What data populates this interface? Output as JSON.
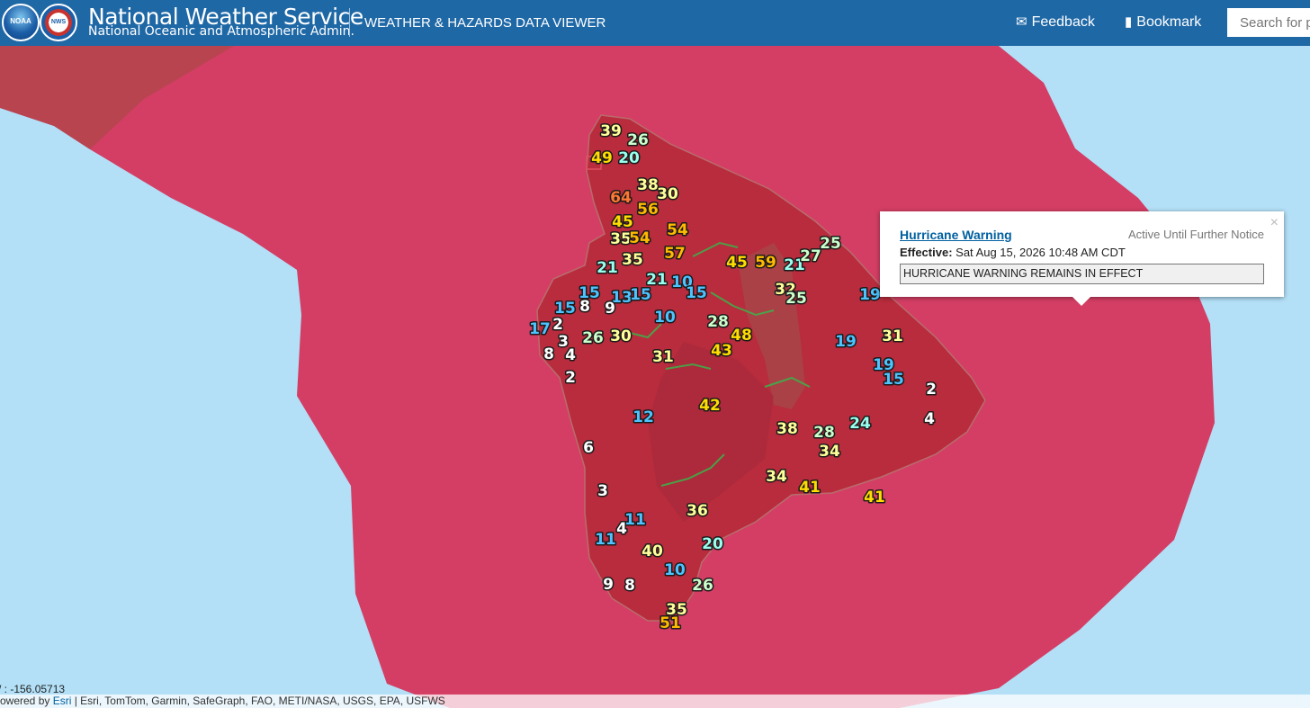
{
  "header": {
    "logo_noaa": "NOAA",
    "logo_nws": "NWS",
    "title": "National Weather Service",
    "subtitle": "National Oceanic and Atmospheric Admin.",
    "viewer_title": "WEATHER & HAZARDS DATA VIEWER",
    "feedback_label": "Feedback",
    "feedback_icon": "envelope-icon",
    "bookmark_label": "Bookmark",
    "bookmark_icon": "bookmark-icon",
    "search_placeholder": "Search for p"
  },
  "popup": {
    "title": "Hurricane Warning",
    "status": "Active Until Further Notice",
    "effective_label": "Effective:",
    "effective_value": "Sat Aug 15, 2026 10:48 AM CDT",
    "message": "HURRICANE WARNING REMAINS IN EFFECT",
    "close_glyph": "×"
  },
  "map": {
    "ocean_color": "#b3e0f7",
    "warning_color": "#d43e64",
    "island_color": "#b82c3d",
    "coords_text": "/ : -156.05713",
    "attribution_prefix": "owered by ",
    "attribution_link": "Esri",
    "attribution_rest": " | Esri, TomTom, Garmin, SafeGraph, FAO, METI/NASA, USGS, EPA, USFWS",
    "observations": [
      {
        "value": "39",
        "color": "#ffff99"
      },
      {
        "value": "26",
        "color": "#ccffcc"
      },
      {
        "value": "49",
        "color": "#ffdd00"
      },
      {
        "value": "20",
        "color": "#99ffee"
      },
      {
        "value": "38",
        "color": "#ffff99"
      },
      {
        "value": "30",
        "color": "#ffff99"
      },
      {
        "value": "64",
        "color": "#ff7733"
      },
      {
        "value": "56",
        "color": "#ffbb00"
      },
      {
        "value": "45",
        "color": "#ffdd00"
      },
      {
        "value": "54",
        "color": "#ffbb00"
      },
      {
        "value": "35",
        "color": "#ffff99"
      },
      {
        "value": "54",
        "color": "#ffbb00"
      },
      {
        "value": "35",
        "color": "#ffff99"
      },
      {
        "value": "57",
        "color": "#ffbb00"
      },
      {
        "value": "21",
        "color": "#99ffee"
      },
      {
        "value": "21",
        "color": "#99ffee"
      },
      {
        "value": "10",
        "color": "#4dc3ff"
      },
      {
        "value": "15",
        "color": "#4dc3ff"
      },
      {
        "value": "15",
        "color": "#4dc3ff"
      },
      {
        "value": "13",
        "color": "#4dc3ff"
      },
      {
        "value": "15",
        "color": "#4dc3ff"
      },
      {
        "value": "15",
        "color": "#4dc3ff"
      },
      {
        "value": "8",
        "color": "#ffffff"
      },
      {
        "value": "9",
        "color": "#ffffff"
      },
      {
        "value": "10",
        "color": "#4dc3ff"
      },
      {
        "value": "17",
        "color": "#4dc3ff"
      },
      {
        "value": "2",
        "color": "#ffffff"
      },
      {
        "value": "3",
        "color": "#ffffff"
      },
      {
        "value": "26",
        "color": "#ccffcc"
      },
      {
        "value": "30",
        "color": "#ffff99"
      },
      {
        "value": "8",
        "color": "#ffffff"
      },
      {
        "value": "4",
        "color": "#ffffff"
      },
      {
        "value": "2",
        "color": "#ffffff"
      },
      {
        "value": "31",
        "color": "#ffff99"
      },
      {
        "value": "28",
        "color": "#ccffcc"
      },
      {
        "value": "48",
        "color": "#ffdd00"
      },
      {
        "value": "43",
        "color": "#ffdd00"
      },
      {
        "value": "45",
        "color": "#ffdd00"
      },
      {
        "value": "59",
        "color": "#ffbb00"
      },
      {
        "value": "21",
        "color": "#99ffee"
      },
      {
        "value": "27",
        "color": "#ccffcc"
      },
      {
        "value": "25",
        "color": "#ccffcc"
      },
      {
        "value": "32",
        "color": "#ffff99"
      },
      {
        "value": "25",
        "color": "#ccffcc"
      },
      {
        "value": "19",
        "color": "#4dc3ff"
      },
      {
        "value": "19",
        "color": "#4dc3ff"
      },
      {
        "value": "31",
        "color": "#ffff99"
      },
      {
        "value": "19",
        "color": "#4dc3ff"
      },
      {
        "value": "15",
        "color": "#4dc3ff"
      },
      {
        "value": "2",
        "color": "#ffffff"
      },
      {
        "value": "42",
        "color": "#ffdd00"
      },
      {
        "value": "12",
        "color": "#4dc3ff"
      },
      {
        "value": "6",
        "color": "#ffffff"
      },
      {
        "value": "38",
        "color": "#ffff99"
      },
      {
        "value": "28",
        "color": "#ccffcc"
      },
      {
        "value": "24",
        "color": "#99ffee"
      },
      {
        "value": "4",
        "color": "#ffffff"
      },
      {
        "value": "34",
        "color": "#ffff99"
      },
      {
        "value": "34",
        "color": "#ffff99"
      },
      {
        "value": "41",
        "color": "#ffdd00"
      },
      {
        "value": "41",
        "color": "#ffdd00"
      },
      {
        "value": "3",
        "color": "#ffffff"
      },
      {
        "value": "36",
        "color": "#ffff99"
      },
      {
        "value": "11",
        "color": "#4dc3ff"
      },
      {
        "value": "4",
        "color": "#ffffff"
      },
      {
        "value": "11",
        "color": "#4dc3ff"
      },
      {
        "value": "40",
        "color": "#ffff99"
      },
      {
        "value": "20",
        "color": "#99ffee"
      },
      {
        "value": "10",
        "color": "#4dc3ff"
      },
      {
        "value": "9",
        "color": "#ffffff"
      },
      {
        "value": "8",
        "color": "#ffffff"
      },
      {
        "value": "26",
        "color": "#ccffcc"
      },
      {
        "value": "35",
        "color": "#ffff99"
      },
      {
        "value": "51",
        "color": "#ffbb00"
      }
    ]
  }
}
